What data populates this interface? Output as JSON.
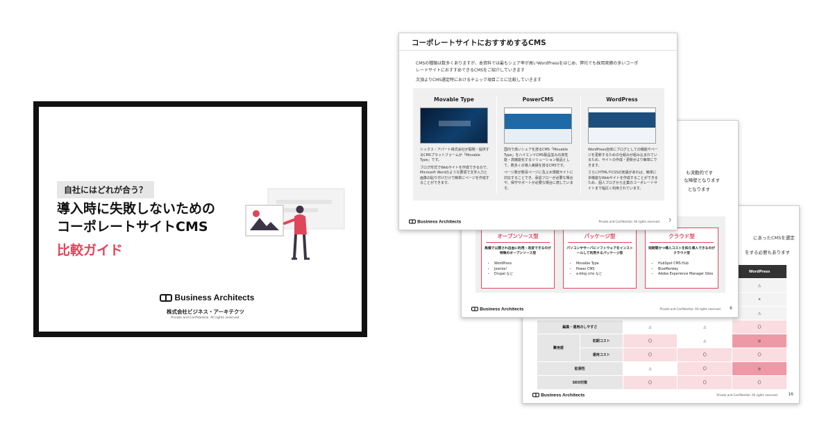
{
  "cover": {
    "badge": "自社にはどれが合う？",
    "title_line1": "導入時に失敗しないための",
    "title_line2": "コーポレートサイトCMS",
    "subtitle": "比較ガイド",
    "logo_text": "Business Architects",
    "company": "株式会社ビジネス・アーキテクツ",
    "confidential": "Private and Confidential. All rights reserved."
  },
  "slide1": {
    "title": "コーポレートサイトにおすすめするCMS",
    "intro_line1": "CMSの種類は数多くありますが、本資料では最もシェア率が高いWordPressをはじめ、弊社でも採用実績の多いコーポ",
    "intro_line2": "レートサイトにおすすめできるCMSをご紹介していきます",
    "intro_line3": "次頂よりCMS選定時におけるチェック項目ごとに比較していきます",
    "cms": [
      {
        "name": "Movable Type",
        "desc1": "シックス・アパート株式会社が開発・提供するCMSプラットフォームが「Movable Type」です。",
        "desc2": "ブログ形式でWebサイトを作成できるので、Microsoft Wordのような要領で文字入力と画像の貼り付けだけで簡単にページを作成することができます。"
      },
      {
        "name": "PowerCMS",
        "desc1": "国内で高いシェアを誇るCMS「Movable Type」をハイエンドCMS製品並みの高性能・高機能化するソリューション製品として、数多くの導入実績を誇るCMSです。",
        "desc2": "ページ数が数百ページに及ぶ大規模サイトに対応することでき、承認フローが必要な場合や、保守サポートが必要な場合に適しています。"
      },
      {
        "name": "WordPress",
        "desc1": "WordPress自体にブログとしての機能やページを更新するための仕組みが組み込まれているため、サイトの作成・更新がより簡単にできます。",
        "desc2": "さらにHTMLやCSSの知識があれば、簡単に多機能なWebサイトを作成することができるため、個人ブログから企業のコーポレートサイトまで幅広く利用されています。"
      }
    ],
    "conf": "Private and Confidential. All rights reserved.",
    "page": "7"
  },
  "slide2": {
    "side1": "も流動的です",
    "side2": "な障壁となります",
    "side3": "となります",
    "boxes": [
      {
        "title": "オープンソース型",
        "desc": "無償で公開され自由に利用・改変できるのが特徴のオープンソース型",
        "items": [
          "WordPress",
          "Joomla!",
          "Drupal など"
        ]
      },
      {
        "title": "パッケージ型",
        "desc": "パソコンやサーバにソフトウェアをインストールして利用するパッケージ型",
        "items": [
          "Movable Type",
          "Power CMS",
          "a-blog cms など"
        ]
      },
      {
        "title": "クラウド型",
        "desc": "短期間かつ導入コストを抑え導入できるのがクラウド型",
        "items": [
          "HubSpot CMS Hub",
          "BlueMonkey",
          "Adobe Experience Manager Sites"
        ]
      }
    ],
    "conf": "Private and Confidential. All rights reserved.",
    "page": "6"
  },
  "slide3": {
    "sub1": "にあったCMSを選定",
    "sub2": "をする必要もあります",
    "col_header": "WordPress",
    "rows": [
      {
        "cat": "",
        "label": "",
        "vals": [
          "",
          "",
          "△"
        ]
      },
      {
        "cat": "",
        "label": "",
        "vals": [
          "",
          "",
          "×"
        ]
      },
      {
        "cat": "",
        "label": "",
        "vals": [
          "",
          "",
          "△"
        ]
      },
      {
        "cat": "",
        "label": "編集・運用のしやすさ",
        "vals": [
          "△",
          "△",
          "〇"
        ]
      },
      {
        "cat": "費用感",
        "label": "初期コスト",
        "vals": [
          "〇",
          "△",
          "◎"
        ]
      },
      {
        "cat": "",
        "label": "運用コスト",
        "vals": [
          "〇",
          "〇",
          "〇"
        ]
      },
      {
        "cat": "",
        "label": "拡張性",
        "vals": [
          "△",
          "〇",
          "◎"
        ]
      },
      {
        "cat": "",
        "label": "SEO対策",
        "vals": [
          "〇",
          "〇",
          "〇"
        ]
      }
    ],
    "conf": "Private and Confidential. All rights reserved.",
    "page": "16"
  }
}
